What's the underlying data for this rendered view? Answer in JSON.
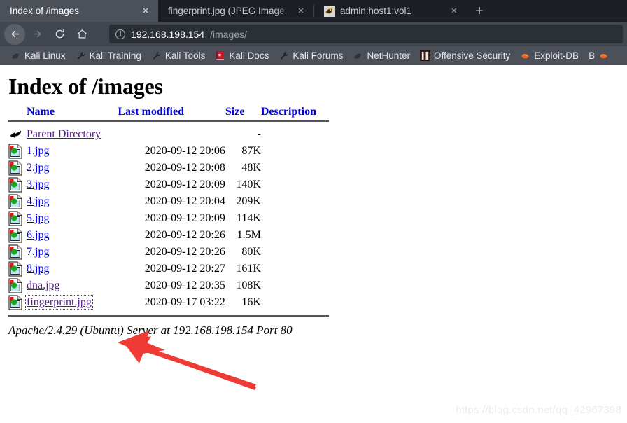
{
  "browser": {
    "tabs": [
      {
        "title": "Index of /images",
        "active": true,
        "favicon": "none"
      },
      {
        "title": "fingerprint.jpg (JPEG Image,",
        "active": false,
        "favicon": "none"
      },
      {
        "title": "admin:host1:vol1",
        "active": false,
        "favicon": "kali-dragon-icon"
      }
    ],
    "tab_close_label": "×",
    "new_tab_label": "+",
    "nav": {
      "back_label": "←",
      "forward_label": "→",
      "reload_label": "↻",
      "home_label": "⌂"
    },
    "url": {
      "info_label": "i",
      "host": "192.168.198.154",
      "path": "/images/"
    },
    "bookmarks": [
      {
        "label": "Kali Linux",
        "icon": "kali-dragon-icon"
      },
      {
        "label": "Kali Training",
        "icon": "wrench-icon"
      },
      {
        "label": "Kali Tools",
        "icon": "wrench-icon"
      },
      {
        "label": "Kali Docs",
        "icon": "red-book-icon"
      },
      {
        "label": "Kali Forums",
        "icon": "wrench-icon"
      },
      {
        "label": "NetHunter",
        "icon": "kali-dragon-icon"
      },
      {
        "label": "Offensive Security",
        "icon": "offsec-icon"
      },
      {
        "label": "Exploit-DB",
        "icon": "exploit-db-icon"
      },
      {
        "label": "B",
        "icon": "exploit-db-icon"
      }
    ]
  },
  "page": {
    "title": "Index of /images",
    "headers": {
      "name": "Name",
      "last_modified": "Last modified",
      "size": "Size",
      "description": "Description"
    },
    "parent": {
      "label": "Parent Directory",
      "size": "-",
      "icon": "back-arrow-icon"
    },
    "rows": [
      {
        "name": "1.jpg",
        "modified": "2020-09-12 20:06",
        "size": "87K",
        "desc": "",
        "state": "link",
        "icon": "image-file-icon"
      },
      {
        "name": "2.jpg",
        "modified": "2020-09-12 20:08",
        "size": "48K",
        "desc": "",
        "state": "link",
        "icon": "image-file-icon"
      },
      {
        "name": "3.jpg",
        "modified": "2020-09-12 20:09",
        "size": "140K",
        "desc": "",
        "state": "link",
        "icon": "image-file-icon"
      },
      {
        "name": "4.jpg",
        "modified": "2020-09-12 20:04",
        "size": "209K",
        "desc": "",
        "state": "link",
        "icon": "image-file-icon"
      },
      {
        "name": "5.jpg",
        "modified": "2020-09-12 20:09",
        "size": "114K",
        "desc": "",
        "state": "link",
        "icon": "image-file-icon"
      },
      {
        "name": "6.jpg",
        "modified": "2020-09-12 20:26",
        "size": "1.5M",
        "desc": "",
        "state": "link",
        "icon": "image-file-icon"
      },
      {
        "name": "7.jpg",
        "modified": "2020-09-12 20:26",
        "size": "80K",
        "desc": "",
        "state": "link",
        "icon": "image-file-icon"
      },
      {
        "name": "8.jpg",
        "modified": "2020-09-12 20:27",
        "size": "161K",
        "desc": "",
        "state": "link",
        "icon": "image-file-icon"
      },
      {
        "name": "dna.jpg",
        "modified": "2020-09-12 20:35",
        "size": "108K",
        "desc": "",
        "state": "visited",
        "icon": "image-file-icon"
      },
      {
        "name": "fingerprint.jpg",
        "modified": "2020-09-17 03:22",
        "size": "16K",
        "desc": "",
        "state": "focused",
        "icon": "image-file-icon"
      }
    ],
    "footer": "Apache/2.4.29 (Ubuntu) Server at 192.168.198.154 Port 80"
  },
  "annotation": {
    "arrow_color": "#ef3b36",
    "arrow_name": "red-pointer-arrow"
  },
  "watermark": "https://blog.csdn.net/qq_42967398",
  "colors": {
    "link": "#0000ee",
    "visited": "#551a8b",
    "chrome_dark": "#1c2026",
    "chrome_mid": "#42474f",
    "chrome_light": "#4b5059"
  }
}
